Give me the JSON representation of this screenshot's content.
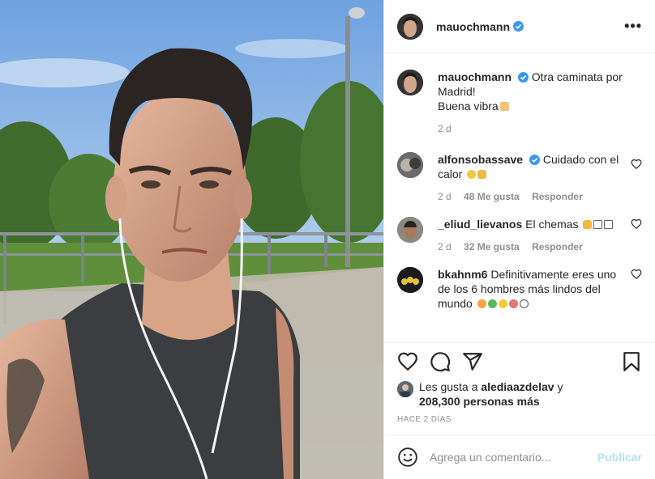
{
  "post": {
    "author": "mauochmann",
    "more_label": "•••"
  },
  "caption": {
    "user": "mauochmann",
    "text_line1": "Otra caminata por",
    "text_line2": "Madrid!",
    "text_line3": "Buena vibra",
    "time": "2 d"
  },
  "comments": [
    {
      "user": "alfonsobassave",
      "verified": true,
      "text": "Cuidado con el calor",
      "time": "2 d",
      "likes": "48 Me gusta",
      "reply": "Responder"
    },
    {
      "user": "_eliud_lievanos",
      "verified": false,
      "text": "El chemas",
      "time": "2 d",
      "likes": "32 Me gusta",
      "reply": "Responder"
    },
    {
      "user": "bkahnm6",
      "verified": false,
      "text": "Definitivamente eres uno de los 6 hombres más lindos del mundo"
    }
  ],
  "likes": {
    "prefix": "Les gusta a",
    "first_user": "alediaazdelav",
    "suffix": "y",
    "count": "208,300 personas más"
  },
  "date_label": "HACE 2 DÍAS",
  "add_comment": {
    "placeholder": "Agrega un comentario...",
    "post_label": "Publicar"
  },
  "colors": {
    "verified": "#3897f0",
    "post_button": "#b2dffc",
    "meta": "#8e8e8e"
  }
}
